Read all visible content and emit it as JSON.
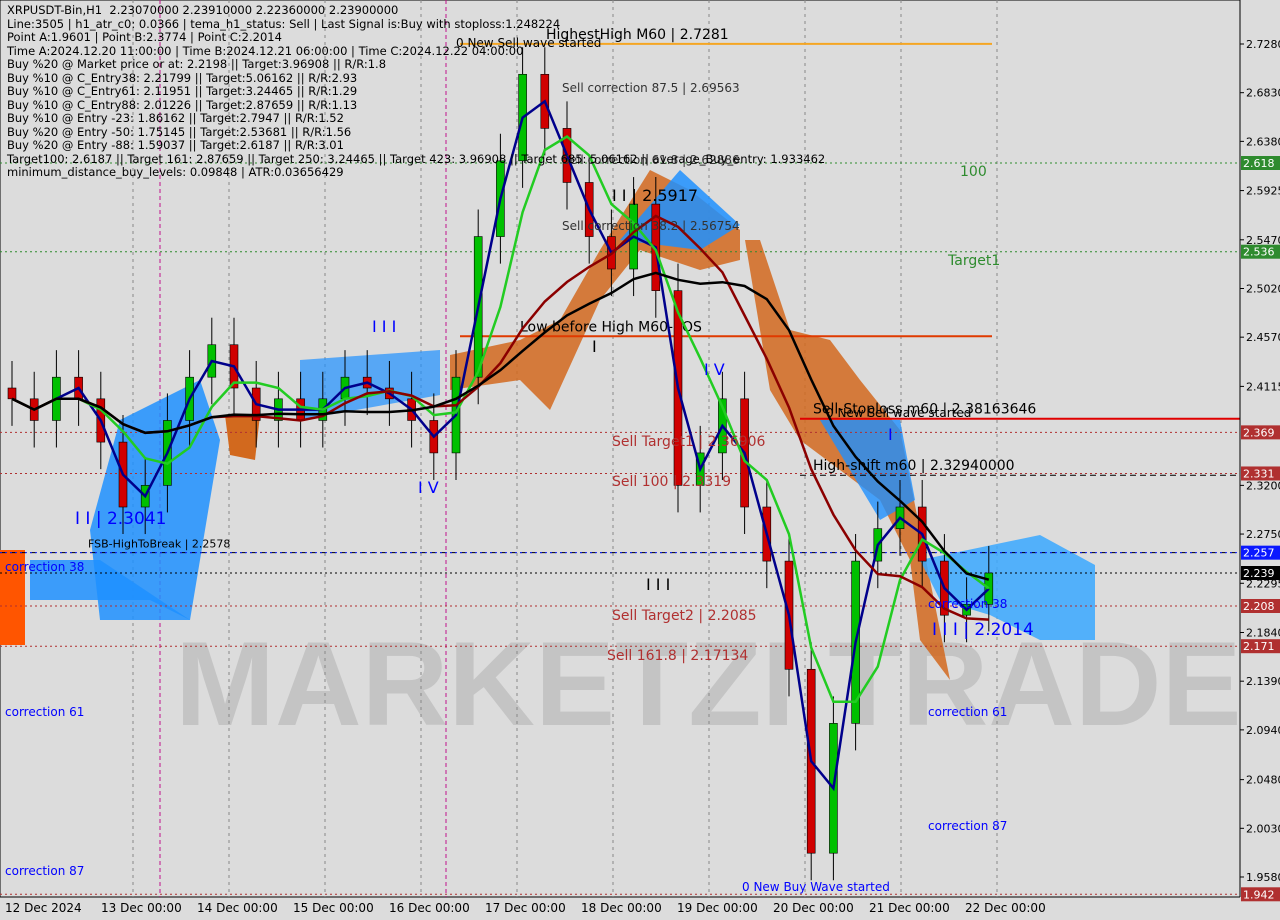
{
  "chart_data": {
    "type": "candlestick",
    "symbol": "XRPUSDT-Bin,H1",
    "ohlc_header": "2.23070000 2.23910000 2.22360000 2.23900000",
    "x_tick_labels": [
      "12 Dec 2024",
      "13 Dec 00:00",
      "14 Dec 00:00",
      "15 Dec 00:00",
      "16 Dec 00:00",
      "17 Dec 00:00",
      "18 Dec 00:00",
      "19 Dec 00:00",
      "20 Dec 00:00",
      "21 Dec 00:00",
      "22 Dec 00:00"
    ],
    "y_tick_labels": [
      "2.7280",
      "2.6830",
      "2.6380",
      "2.5925",
      "2.5470",
      "2.5020",
      "2.4570",
      "2.4115",
      "2.3200",
      "2.2750",
      "2.2295",
      "2.1840",
      "2.1390",
      "2.0940",
      "2.0480",
      "2.0030",
      "1.9580"
    ],
    "ylim": [
      1.935,
      2.765
    ],
    "approx_closes": [
      2.4,
      2.38,
      2.42,
      2.4,
      2.36,
      2.3,
      2.32,
      2.38,
      2.42,
      2.45,
      2.41,
      2.38,
      2.4,
      2.38,
      2.4,
      2.42,
      2.41,
      2.4,
      2.38,
      2.35,
      2.42,
      2.55,
      2.62,
      2.7,
      2.65,
      2.6,
      2.55,
      2.52,
      2.58,
      2.5,
      2.32,
      2.35,
      2.4,
      2.3,
      2.25,
      2.15,
      1.98,
      2.1,
      2.25,
      2.28,
      2.3,
      2.25,
      2.2,
      2.21,
      2.239
    ],
    "price_badges": [
      {
        "label": "2.618",
        "color": "#2e8b2e",
        "value": 2.618
      },
      {
        "label": "2.536",
        "color": "#2e8b2e",
        "value": 2.536
      },
      {
        "label": "2.369",
        "color": "#b03030",
        "value": 2.369
      },
      {
        "label": "2.331",
        "color": "#b03030",
        "value": 2.331
      },
      {
        "label": "2.257",
        "color": "#0a18ff",
        "value": 2.2578
      },
      {
        "label": "2.239",
        "color": "#000000",
        "value": 2.239
      },
      {
        "label": "2.208",
        "color": "#b03030",
        "value": 2.2085
      },
      {
        "label": "2.171",
        "color": "#b03030",
        "value": 2.17134
      },
      {
        "label": "1.942",
        "color": "#b03030",
        "value": 1.942
      }
    ],
    "levels": [
      {
        "label": "HighestHigh   M60 | 2.7281",
        "value": 2.7281,
        "color": "#f5a623"
      },
      {
        "label": "Low before High   M60-BOS",
        "value": 2.4578,
        "color": "#e03a00"
      },
      {
        "label": "Sell-Stoploss m60 | 2.38163646",
        "value": 2.3816,
        "color": "#e00000"
      },
      {
        "label": "High-shift m60 | 2.32940000",
        "value": 2.3294,
        "color": "#000000"
      },
      {
        "label": "FSB-HighToBreak | 2.2578",
        "value": 2.2578,
        "color": "#000000"
      }
    ],
    "annotations": [
      {
        "text": "0 New Sell wave started",
        "value": 2.728
      },
      {
        "text": "Sell correction 87.5 | 2.69563",
        "value": 2.69563
      },
      {
        "text": "Sell correction 61.8 | 2.62886",
        "value": 2.62886
      },
      {
        "text": "Sell correction 38.2 | 2.56754",
        "value": 2.56754
      },
      {
        "text": "I I | 2.5917",
        "value": 2.5917
      },
      {
        "text": "100",
        "value": 2.618
      },
      {
        "text": "Target1",
        "value": 2.536
      },
      {
        "text": "Sell Target1 | 2.36906",
        "value": 2.36906
      },
      {
        "text": "Sell 100 | 2.3319",
        "value": 2.3319
      },
      {
        "text": "Sell Target2 | 2.2085",
        "value": 2.2085
      },
      {
        "text": "Sell 161.8 | 2.17134",
        "value": 2.17134
      },
      {
        "text": "I I | 2.3041",
        "value": 2.3041
      },
      {
        "text": "I I I | 2.2014",
        "value": 2.2014
      },
      {
        "text": "0 New Sell wave started",
        "value": 2.38
      },
      {
        "text": "0 New Buy Wave started",
        "value": 1.945
      },
      {
        "text": "correction 38",
        "value": 2.229
      },
      {
        "text": "correction 61",
        "value": 2.119
      },
      {
        "text": "correction 87",
        "value": 2.012
      }
    ],
    "wave_labels": [
      "I I I",
      "I V",
      "I",
      "I V",
      "I I I",
      "I"
    ],
    "watermark": "MARKETZI TRADE"
  },
  "info_lines": [
    "XRPUSDT-Bin,H1  2.23070000 2.23910000 2.22360000 2.23900000",
    "Line:3505 | h1_atr_c0: 0.0366 | tema_h1_status: Sell | Last Signal is:Buy with stoploss:1.248224",
    "Point A:1.9601 | Point B:2.3774 | Point C:2.2014",
    "Time A:2024.12.20 11:00:00 | Time B:2024.12.21 06:00:00 | Time C:2024.12.22 04:00:00",
    "Buy %20 @ Market price or at: 2.2198 || Target:3.96908 || R/R:1.8",
    "Buy %10 @ C_Entry38: 2.21799 || Target:5.06162 || R/R:2.93",
    "Buy %10 @ C_Entry61: 2.11951 || Target:3.24465 || R/R:1.29",
    "Buy %10 @ C_Entry88: 2.01226 || Target:2.87659 || R/R:1.13",
    "Buy %10 @ Entry -23: 1.86162 || Target:2.7947 || R/R:1.52",
    "Buy %20 @ Entry -50: 1.75145 || Target:2.53681 || R/R:1.56",
    "Buy %20 @ Entry -88: 1.59037 || Target:2.6187 || R/R:3.01",
    "Target100: 2.6187 || Target 161: 2.87659 || Target 250: 3.24465 || Target 423: 3.96908 || Target 685: 5.06162 || average_Buy_entry: 1.933462",
    "minimum_distance_buy_levels: 0.09848 | ATR:0.03656429"
  ],
  "colors": {
    "bull": "#00c000",
    "bear": "#d00000",
    "cloud_blue": "#1e90ff",
    "cloud_orange": "#d2691e",
    "ma_black": "#000000",
    "ma_darkred": "#8b0000",
    "ma_green": "#22cc22",
    "ma_navy": "#00008b"
  }
}
